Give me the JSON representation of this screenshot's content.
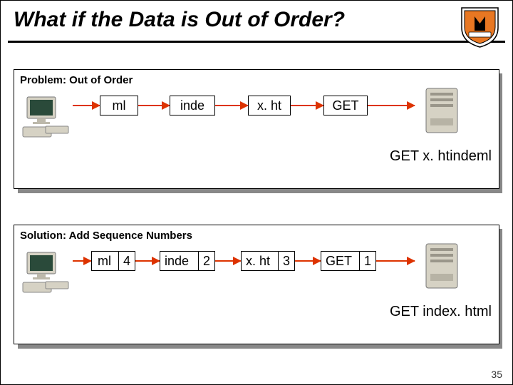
{
  "title": "What if the Data is Out of Order?",
  "panels": {
    "problem": {
      "label": "Problem: Out of Order",
      "packets": [
        "ml",
        "inde",
        "x. ht",
        "GET"
      ],
      "result": "GET x. htindeml"
    },
    "solution": {
      "label": "Solution: Add Sequence Numbers",
      "packets": [
        {
          "txt": "ml",
          "seq": "4"
        },
        {
          "txt": "inde",
          "seq": "2"
        },
        {
          "txt": "x. ht",
          "seq": "3"
        },
        {
          "txt": "GET",
          "seq": "1"
        }
      ],
      "result": "GET index. html"
    }
  },
  "page_number": "35"
}
